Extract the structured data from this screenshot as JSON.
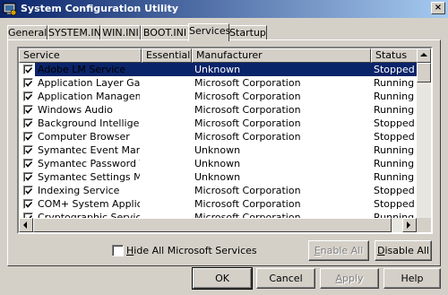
{
  "window": {
    "title": "System Configuration Utility",
    "close_glyph": "×"
  },
  "tabs": [
    {
      "label": "General",
      "active": false
    },
    {
      "label": "SYSTEM.INI",
      "active": false
    },
    {
      "label": "WIN.INI",
      "active": false
    },
    {
      "label": "BOOT.INI",
      "active": false
    },
    {
      "label": "Services",
      "active": true
    },
    {
      "label": "Startup",
      "active": false
    }
  ],
  "list": {
    "columns": [
      "Service",
      "Essential",
      "Manufacturer",
      "Status"
    ],
    "rows": [
      {
        "checked": true,
        "service": "Adobe LM Service",
        "essential": "",
        "manufacturer": "Unknown",
        "status": "Stopped",
        "selected": true
      },
      {
        "checked": true,
        "service": "Application Layer Gatew...",
        "essential": "",
        "manufacturer": "Microsoft Corporation",
        "status": "Running",
        "selected": false
      },
      {
        "checked": true,
        "service": "Application Management",
        "essential": "",
        "manufacturer": "Microsoft Corporation",
        "status": "Running",
        "selected": false
      },
      {
        "checked": true,
        "service": "Windows Audio",
        "essential": "",
        "manufacturer": "Microsoft Corporation",
        "status": "Running",
        "selected": false
      },
      {
        "checked": true,
        "service": "Background Intelligent T...",
        "essential": "",
        "manufacturer": "Microsoft Corporation",
        "status": "Stopped",
        "selected": false
      },
      {
        "checked": true,
        "service": "Computer Browser",
        "essential": "",
        "manufacturer": "Microsoft Corporation",
        "status": "Stopped",
        "selected": false
      },
      {
        "checked": true,
        "service": "Symantec Event Manager",
        "essential": "",
        "manufacturer": "Unknown",
        "status": "Running",
        "selected": false
      },
      {
        "checked": true,
        "service": "Symantec Password Vali...",
        "essential": "",
        "manufacturer": "Unknown",
        "status": "Running",
        "selected": false
      },
      {
        "checked": true,
        "service": "Symantec Settings Mana...",
        "essential": "",
        "manufacturer": "Unknown",
        "status": "Running",
        "selected": false
      },
      {
        "checked": true,
        "service": "Indexing Service",
        "essential": "",
        "manufacturer": "Microsoft Corporation",
        "status": "Stopped",
        "selected": false
      },
      {
        "checked": true,
        "service": "COM+ System Application",
        "essential": "",
        "manufacturer": "Microsoft Corporation",
        "status": "Stopped",
        "selected": false
      },
      {
        "checked": true,
        "service": "Cryptographic Services",
        "essential": "",
        "manufacturer": "Microsoft Corporation",
        "status": "Running",
        "selected": false
      }
    ]
  },
  "options": {
    "hide_ms_label_pre": "",
    "hide_ms_label_accel": "H",
    "hide_ms_label_post": "ide All Microsoft Services",
    "hide_ms_checked": false
  },
  "buttons": {
    "enable_all_accel": "E",
    "enable_all_rest": "nable All",
    "disable_all_accel": "D",
    "disable_all_rest": "isable All",
    "ok": "OK",
    "cancel": "Cancel",
    "apply_accel": "A",
    "apply_rest": "pply",
    "help": "Help"
  },
  "colors": {
    "selection": "#0a246a",
    "titlebar_start": "#0a246a",
    "titlebar_end": "#a6caf0"
  },
  "icons": {
    "app": "msconfig-icon",
    "checkmark": "checkmark-icon",
    "scroll_up": "arrow-up-icon",
    "scroll_down": "arrow-down-icon",
    "scroll_left": "arrow-left-icon",
    "scroll_right": "arrow-right-icon"
  }
}
